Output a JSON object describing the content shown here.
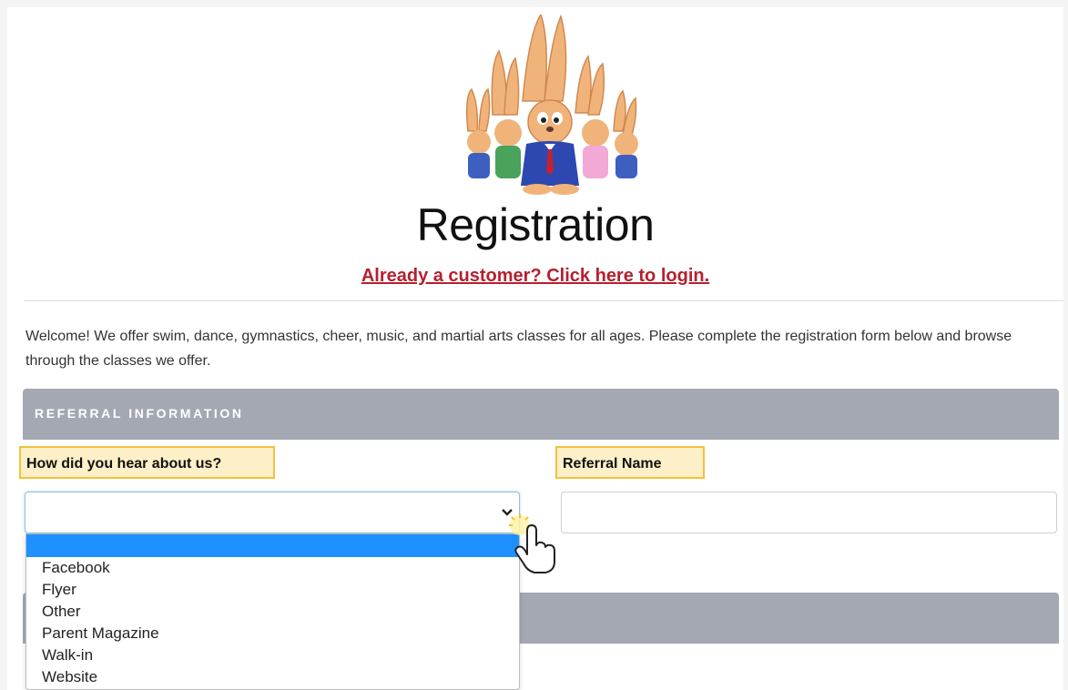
{
  "header": {
    "title": "Registration",
    "login_link": "Already a customer? Click here to login."
  },
  "welcome_text": "Welcome! We offer swim, dance, gymnastics, cheer, music, and martial arts classes for all ages. Please complete the registration form below and browse through the classes we offer.",
  "sections": {
    "referral_title": "REFERRAL INFORMATION"
  },
  "form": {
    "hear_label": "How did you hear about us?",
    "hear_value": "",
    "referral_label": "Referral Name",
    "referral_value": "",
    "options": [
      "",
      "Facebook",
      "Flyer",
      "Other",
      "Parent Magazine",
      "Walk-in",
      "Website"
    ]
  },
  "colors": {
    "link": "#b5202e",
    "section_bar": "#a3a8b3",
    "highlight_fill": "#fdf0c8",
    "highlight_border": "#f2c23e",
    "selected_option": "#1e90ff"
  },
  "icons": {
    "logo": "bunny-family-logo",
    "select_arrow": "chevron-down-icon",
    "pointer": "hand-pointer-icon"
  }
}
